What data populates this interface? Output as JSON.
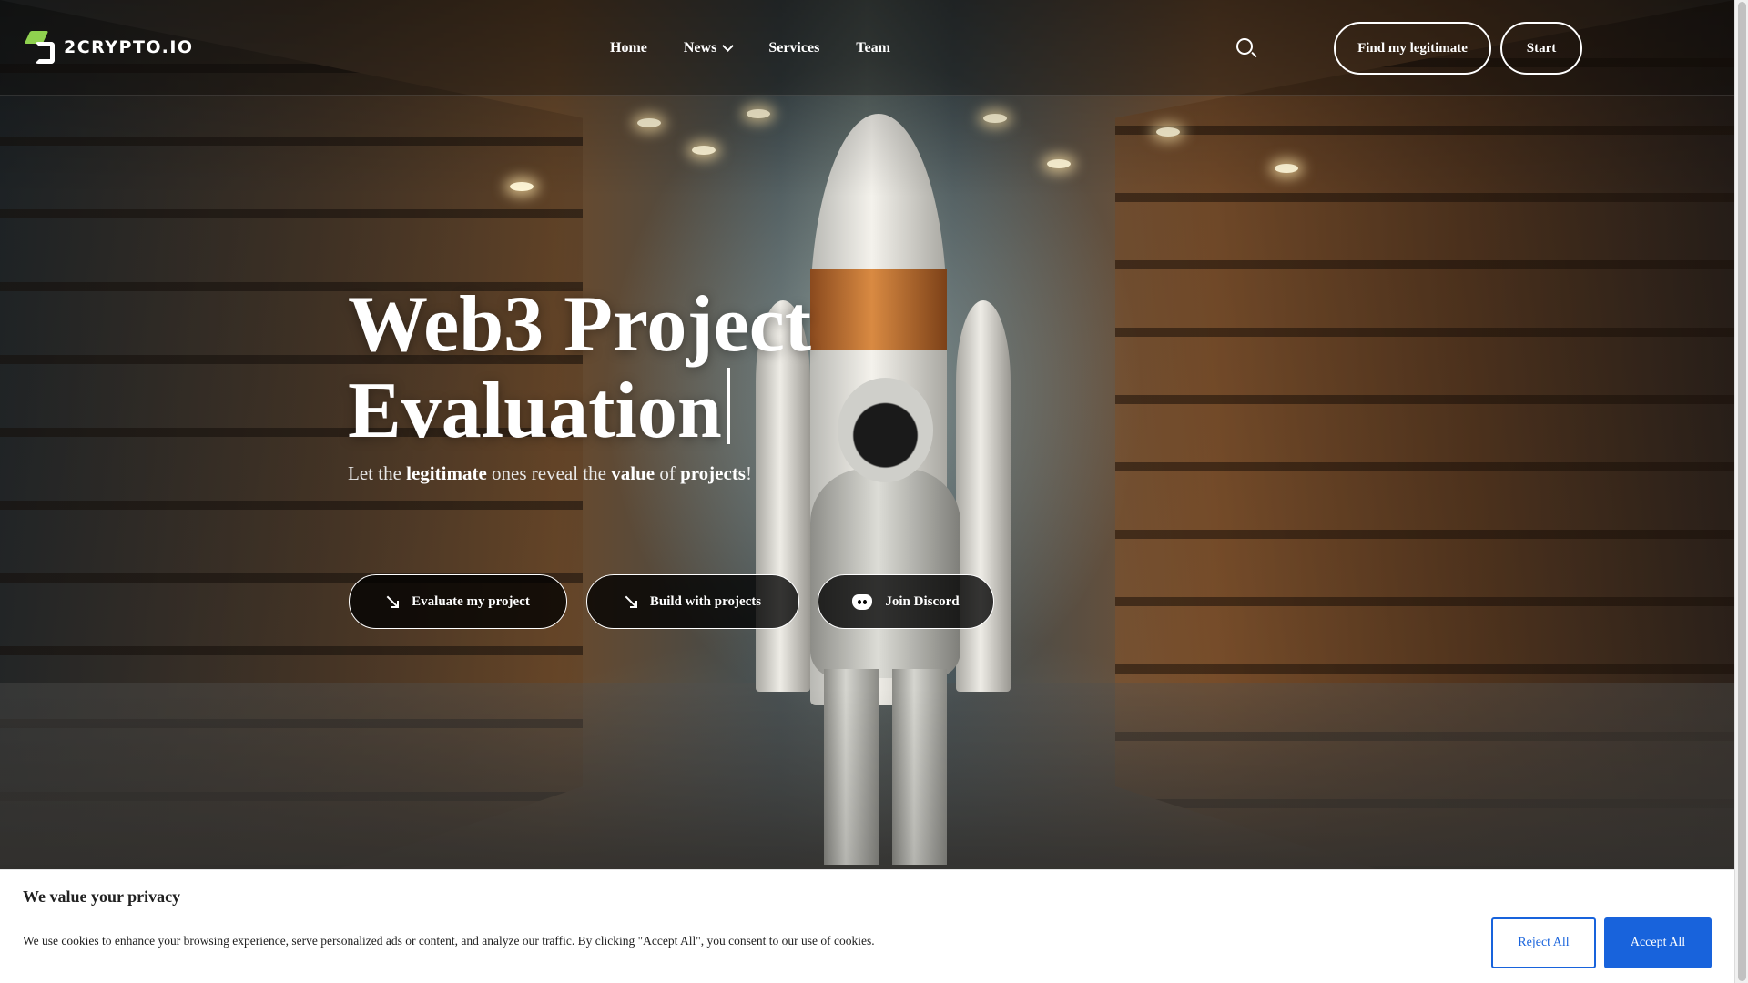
{
  "header": {
    "logo_text": "2CRYPTO.IO",
    "nav": [
      {
        "label": "Home"
      },
      {
        "label": "News",
        "has_dropdown": true
      },
      {
        "label": "Services"
      },
      {
        "label": "Team"
      }
    ],
    "find_button": "Find my legitimate",
    "start_button": "Start"
  },
  "hero": {
    "title_line1": "Web3 Project",
    "title_line2": "Evaluation",
    "subtitle": {
      "p1": "Let the ",
      "b1": "legitimate",
      "p2": " ones reveal the ",
      "b2": "value",
      "p3": " of ",
      "b3": "projects",
      "p4": "!"
    },
    "buttons": {
      "evaluate": "Evaluate my project",
      "build": "Build with projects",
      "discord": "Join Discord"
    }
  },
  "cookie_banner": {
    "title": "We value your privacy",
    "message": "We use cookies to enhance your browsing experience, serve personalized ads or content, and analyze our traffic. By clicking \"Accept All\", you consent to our use of cookies.",
    "reject_label": "Reject All",
    "accept_label": "Accept All"
  },
  "colors": {
    "accent_blue": "#1863dc",
    "logo_green": "#8fd14f",
    "rocket_band_orange": "#d98a42"
  },
  "icons": [
    "logo-mark",
    "chevron-down-icon",
    "search-icon",
    "arrow-down-right-icon",
    "discord-icon"
  ]
}
